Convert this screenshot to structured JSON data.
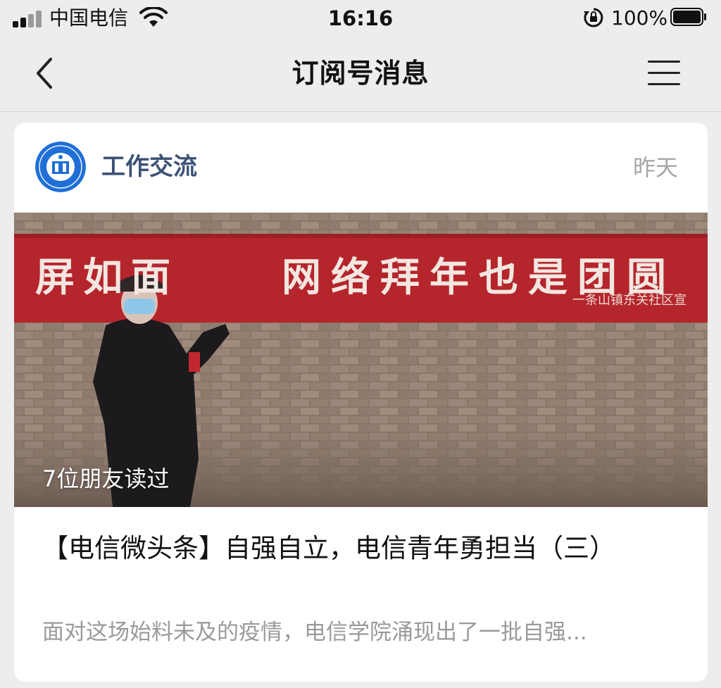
{
  "status_bar": {
    "carrier": "中国电信",
    "time": "16:16",
    "battery": "100%"
  },
  "nav": {
    "title": "订阅号消息",
    "back_icon": "chevron-left-icon",
    "menu_icon": "hamburger-menu-icon"
  },
  "card": {
    "account_name": "工作交流",
    "time": "昨天",
    "cover": {
      "banner_left": "屏如面",
      "banner_right": "网络拜年也是团圆",
      "banner_sub": "一条山镇东关社区宣",
      "read_count": "7位朋友读过"
    },
    "title": "【电信微头条】自强自立，电信青年勇担当（三）",
    "summary": "面对这场始料未及的疫情，电信学院涌现出了一批自强..."
  },
  "colors": {
    "background": "#ededed",
    "account_name": "#3d5275",
    "muted": "#9a9a9a",
    "banner_red": "#b5252c"
  }
}
